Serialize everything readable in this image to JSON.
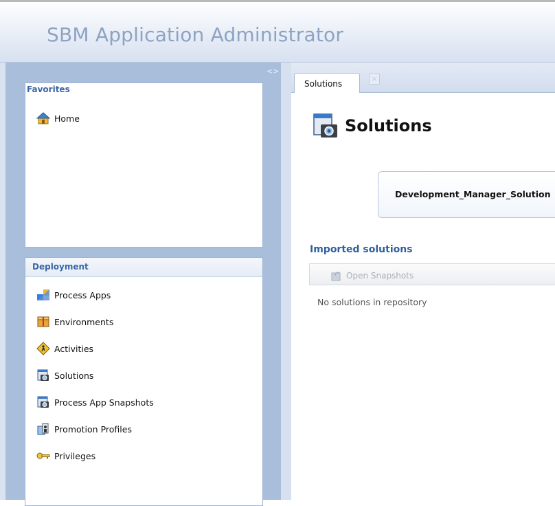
{
  "header": {
    "title": "SBM Application Administrator"
  },
  "left": {
    "collapse_glyph": "<>",
    "favorites": {
      "title": "Favorites",
      "items": [
        {
          "label": "Home",
          "icon": "home-icon"
        }
      ]
    },
    "deployment": {
      "title": "Deployment",
      "items": [
        {
          "label": "Process Apps",
          "icon": "process-apps-icon"
        },
        {
          "label": "Environments",
          "icon": "environments-icon"
        },
        {
          "label": "Activities",
          "icon": "activities-icon"
        },
        {
          "label": "Solutions",
          "icon": "solutions-icon"
        },
        {
          "label": "Process App Snapshots",
          "icon": "snapshots-icon"
        },
        {
          "label": "Promotion Profiles",
          "icon": "promotion-profiles-icon"
        },
        {
          "label": "Privileges",
          "icon": "privileges-icon"
        }
      ]
    }
  },
  "tabs": [
    {
      "label": "Solutions",
      "close_glyph": "×"
    }
  ],
  "main": {
    "title": "Solutions",
    "solution_card": "Development_Manager_Solution",
    "imported_title": "Imported solutions",
    "toolbar": {
      "open_snapshots": "Open Snapshots"
    },
    "empty_text": "No solutions in repository"
  },
  "colors": {
    "accent": "#2f5f9e",
    "sidebar": "#a9bedb",
    "title": "#8da3c3"
  }
}
